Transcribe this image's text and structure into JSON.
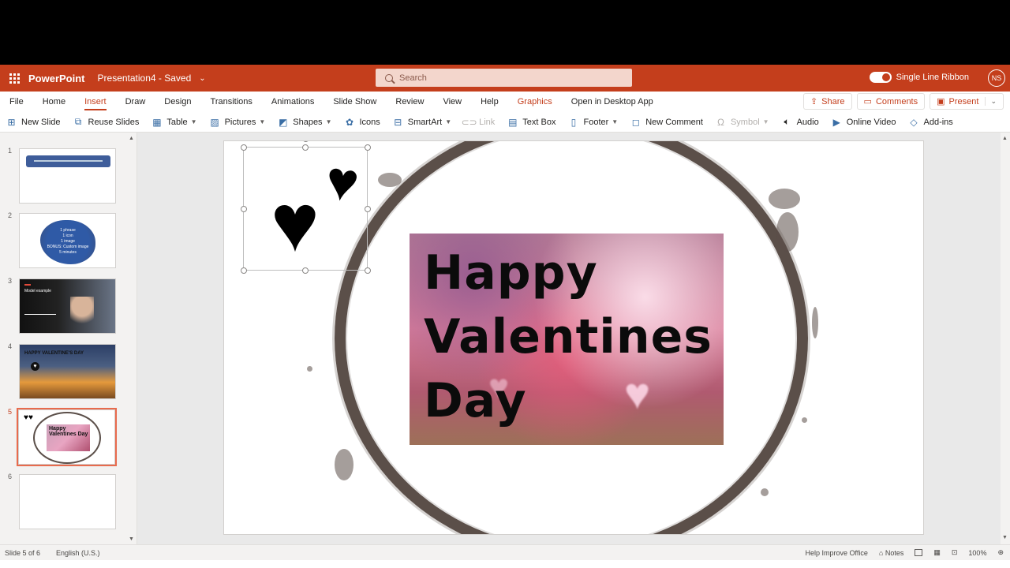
{
  "app": {
    "name": "PowerPoint",
    "doc_title": "Presentation4 - Saved",
    "search_placeholder": "Search",
    "single_line_ribbon": "Single Line Ribbon",
    "avatar_initials": "NS",
    "accent": "#c43e1c"
  },
  "tabs": [
    {
      "label": "File"
    },
    {
      "label": "Home"
    },
    {
      "label": "Insert"
    },
    {
      "label": "Draw"
    },
    {
      "label": "Design"
    },
    {
      "label": "Transitions"
    },
    {
      "label": "Animations"
    },
    {
      "label": "Slide Show"
    },
    {
      "label": "Review"
    },
    {
      "label": "View"
    },
    {
      "label": "Help"
    },
    {
      "label": "Graphics"
    },
    {
      "label": "Open in Desktop App"
    }
  ],
  "actions": {
    "share": "Share",
    "comments": "Comments",
    "present": "Present"
  },
  "ribbon": {
    "new_slide": "New Slide",
    "reuse_slides": "Reuse Slides",
    "table": "Table",
    "pictures": "Pictures",
    "shapes": "Shapes",
    "icons": "Icons",
    "smartart": "SmartArt",
    "link": "Link",
    "text_box": "Text Box",
    "footer": "Footer",
    "new_comment": "New Comment",
    "symbol": "Symbol",
    "audio": "Audio",
    "online_video": "Online Video",
    "add_ins": "Add-ins"
  },
  "thumbnails": {
    "numbers": [
      "1",
      "2",
      "3",
      "4",
      "5",
      "6"
    ],
    "slide2_lines": [
      "1 phrase",
      "1 icon",
      "1 image",
      "BONUS: Custom image",
      "5 minutes"
    ],
    "slide3_text": "Model example",
    "slide4_text": "HAPPY VALENTINE'S DAY",
    "slide5_text": "Happy Valentines Day"
  },
  "slide": {
    "title_lines": [
      "Happy",
      "Valentines",
      "Day"
    ]
  },
  "status": {
    "slide_info": "Slide 5 of 6",
    "language": "English (U.S.)",
    "help_improve": "Help Improve Office",
    "notes": "Notes",
    "zoom": "100%"
  }
}
